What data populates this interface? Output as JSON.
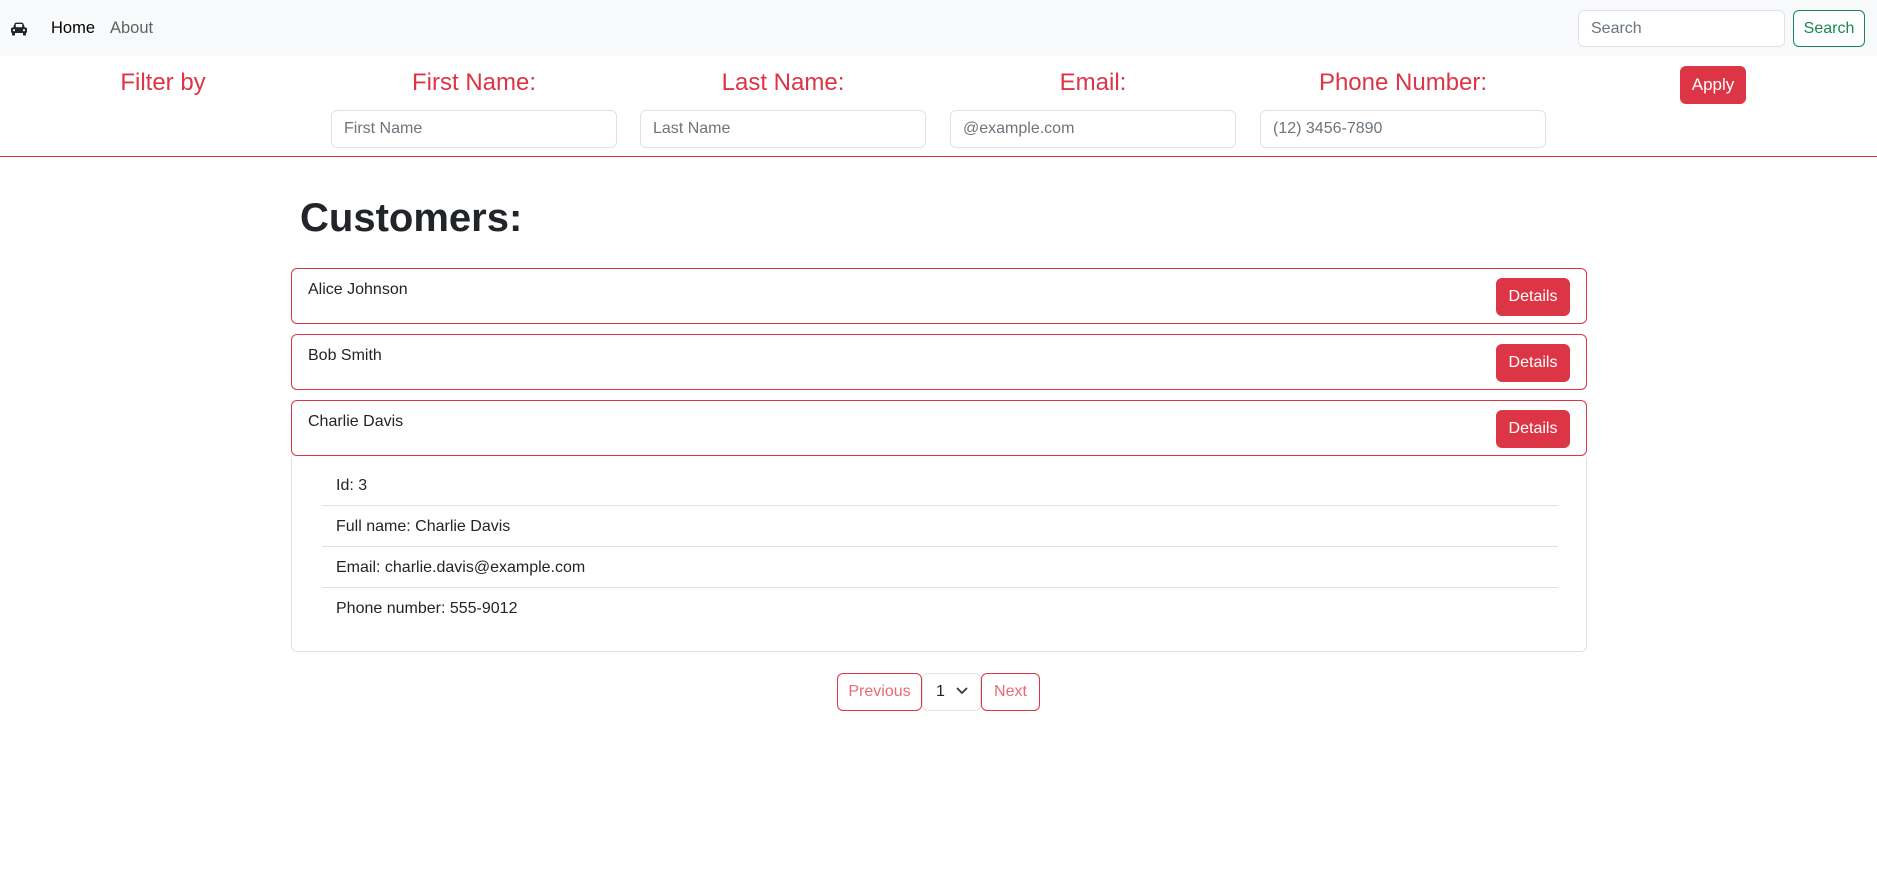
{
  "navbar": {
    "brand_icon": "car-icon",
    "links": [
      {
        "label": "Home"
      },
      {
        "label": "About"
      }
    ],
    "search": {
      "placeholder": "Search",
      "value": "",
      "button_label": "Search"
    }
  },
  "filter": {
    "title": "Filter by",
    "fields": [
      {
        "label": "First Name:",
        "placeholder": "First Name",
        "value": ""
      },
      {
        "label": "Last Name:",
        "placeholder": "Last Name",
        "value": ""
      },
      {
        "label": "Email:",
        "placeholder": "@example.com",
        "value": ""
      },
      {
        "label": "Phone Number:",
        "placeholder": "(12) 3456-7890",
        "value": ""
      }
    ],
    "apply_label": "Apply"
  },
  "main": {
    "title": "Customers:",
    "customers": [
      {
        "name": "Alice Johnson",
        "button_label": "Details"
      },
      {
        "name": "Bob Smith",
        "button_label": "Details"
      },
      {
        "name": "Charlie Davis",
        "button_label": "Details"
      }
    ],
    "details": {
      "id": "Id: 3",
      "full_name": "Full name: Charlie Davis",
      "email": "Email: charlie.davis@example.com",
      "phone": "Phone number: 555-9012"
    }
  },
  "pagination": {
    "previous_label": "Previous",
    "current_page": "1",
    "next_label": "Next"
  },
  "colors": {
    "accent": "#dc3545",
    "success": "#198754",
    "navbar_bg": "#f8f9fa",
    "border": "#dee2e6"
  }
}
